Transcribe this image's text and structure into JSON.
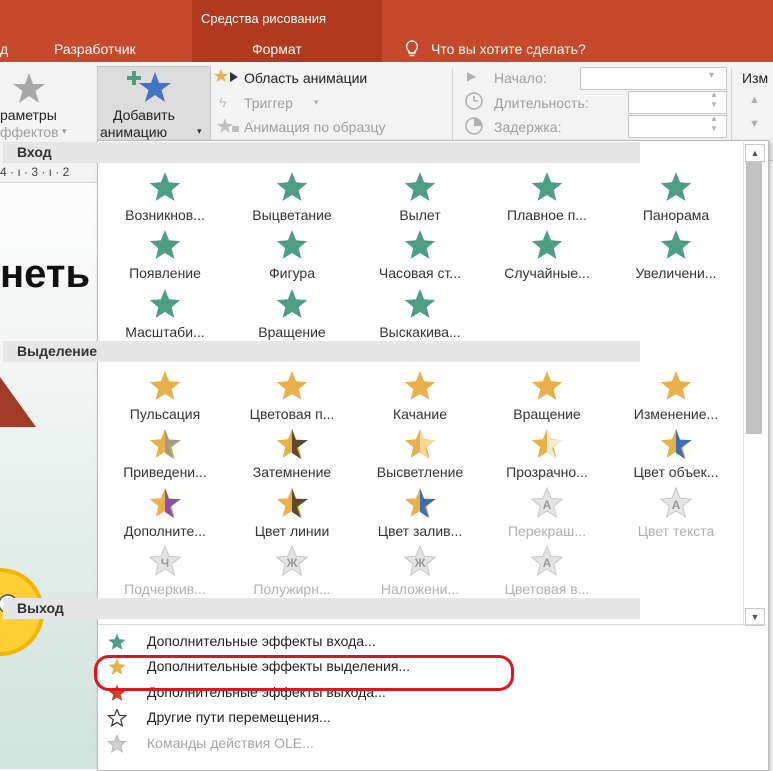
{
  "title_bar": {
    "tab_left_partial": "д",
    "tab_developer": "Разработчик",
    "tools_group": "Средства рисования",
    "tab_format": "Формат",
    "tell_me": "Что вы хотите сделать?"
  },
  "ribbon": {
    "effect_options_line1": "раметры",
    "effect_options_line2": "ффектов",
    "add_animation_line1": "Добавить",
    "add_animation_line2": "анимацию",
    "animation_pane": "Область анимации",
    "trigger": "Триггер",
    "animation_painter": "Анимация по образцу",
    "start_label": "Начало:",
    "duration_label": "Длительность:",
    "delay_label": "Задержка:",
    "reorder_partial": "Изм"
  },
  "ruler": {
    "text": "4 · ı · 3 · ı · 2"
  },
  "slide": {
    "title_partial": "неть"
  },
  "gallery": {
    "sections": {
      "entrance": "Вход",
      "emphasis": "Выделение",
      "exit": "Выход"
    },
    "entrance": [
      {
        "label": "Возникнов...",
        "icon": "appear-star-icon"
      },
      {
        "label": "Выцветание",
        "icon": "fade-star-icon"
      },
      {
        "label": "Вылет",
        "icon": "fly-in-star-icon"
      },
      {
        "label": "Плавное п...",
        "icon": "float-in-star-icon"
      },
      {
        "label": "Панорама",
        "icon": "split-star-icon"
      },
      {
        "label": "Появление",
        "icon": "wipe-star-icon"
      },
      {
        "label": "Фигура",
        "icon": "shape-star-icon"
      },
      {
        "label": "Часовая ст...",
        "icon": "wheel-star-icon"
      },
      {
        "label": "Случайные...",
        "icon": "random-bars-star-icon"
      },
      {
        "label": "Увеличени...",
        "icon": "grow-turn-star-icon"
      },
      {
        "label": "Масштаби...",
        "icon": "zoom-star-icon"
      },
      {
        "label": "Вращение",
        "icon": "swivel-star-icon"
      },
      {
        "label": "Выскакива...",
        "icon": "bounce-star-icon"
      }
    ],
    "emphasis": [
      {
        "label": "Пульсация",
        "icon": "pulse-star-icon"
      },
      {
        "label": "Цветовая п...",
        "icon": "color-pulse-star-icon"
      },
      {
        "label": "Качание",
        "icon": "teeter-star-icon"
      },
      {
        "label": "Вращение",
        "icon": "spin-star-icon"
      },
      {
        "label": "Изменение...",
        "icon": "grow-shrink-star-icon"
      },
      {
        "label": "Приведени...",
        "icon": "desaturate-star-icon"
      },
      {
        "label": "Затемнение",
        "icon": "darken-star-icon"
      },
      {
        "label": "Высветление",
        "icon": "lighten-star-icon"
      },
      {
        "label": "Прозрачно...",
        "icon": "transparency-star-icon"
      },
      {
        "label": "Цвет объек...",
        "icon": "object-color-star-icon"
      },
      {
        "label": "Дополните...",
        "icon": "complementary-color-star-icon"
      },
      {
        "label": "Цвет линии",
        "icon": "line-color-star-icon"
      },
      {
        "label": "Цвет залив...",
        "icon": "fill-color-star-icon"
      },
      {
        "label": "Перекраш...",
        "icon": "brush-color-star-icon",
        "disabled": true,
        "glyph": "A"
      },
      {
        "label": "Цвет текста",
        "icon": "font-color-star-icon",
        "disabled": true,
        "glyph": "A"
      },
      {
        "label": "Подчеркив...",
        "icon": "underline-star-icon",
        "disabled": true,
        "glyph": "Ч"
      },
      {
        "label": "Полужирн...",
        "icon": "bold-flash-star-icon",
        "disabled": true,
        "glyph": "Ж"
      },
      {
        "label": "Наложени...",
        "icon": "bold-reveal-star-icon",
        "disabled": true,
        "glyph": "Ж"
      },
      {
        "label": "Цветовая в...",
        "icon": "wave-star-icon",
        "disabled": true,
        "glyph": "A"
      }
    ]
  },
  "footer": [
    {
      "label": "Дополнительные эффекты входа...",
      "icon": "green-star-icon",
      "disabled": false
    },
    {
      "label": "Дополнительные эффекты выделения...",
      "icon": "gold-star-icon",
      "disabled": false,
      "highlighted": true
    },
    {
      "label": "Дополнительные эффекты выхода...",
      "icon": "red-star-icon",
      "disabled": false
    },
    {
      "label": "Другие пути перемещения...",
      "icon": "outline-star-icon",
      "disabled": false
    },
    {
      "label": "Команды действия OLE...",
      "icon": "ole-gear-icon",
      "disabled": true
    }
  ],
  "colors": {
    "title_bar": "#C5492A",
    "tools_group": "#B0391E",
    "entrance_green": "#4E9E83",
    "emphasis_gold": "#E8B04A",
    "exit_red": "#C9432B",
    "highlight_ring": "#E0141E"
  }
}
